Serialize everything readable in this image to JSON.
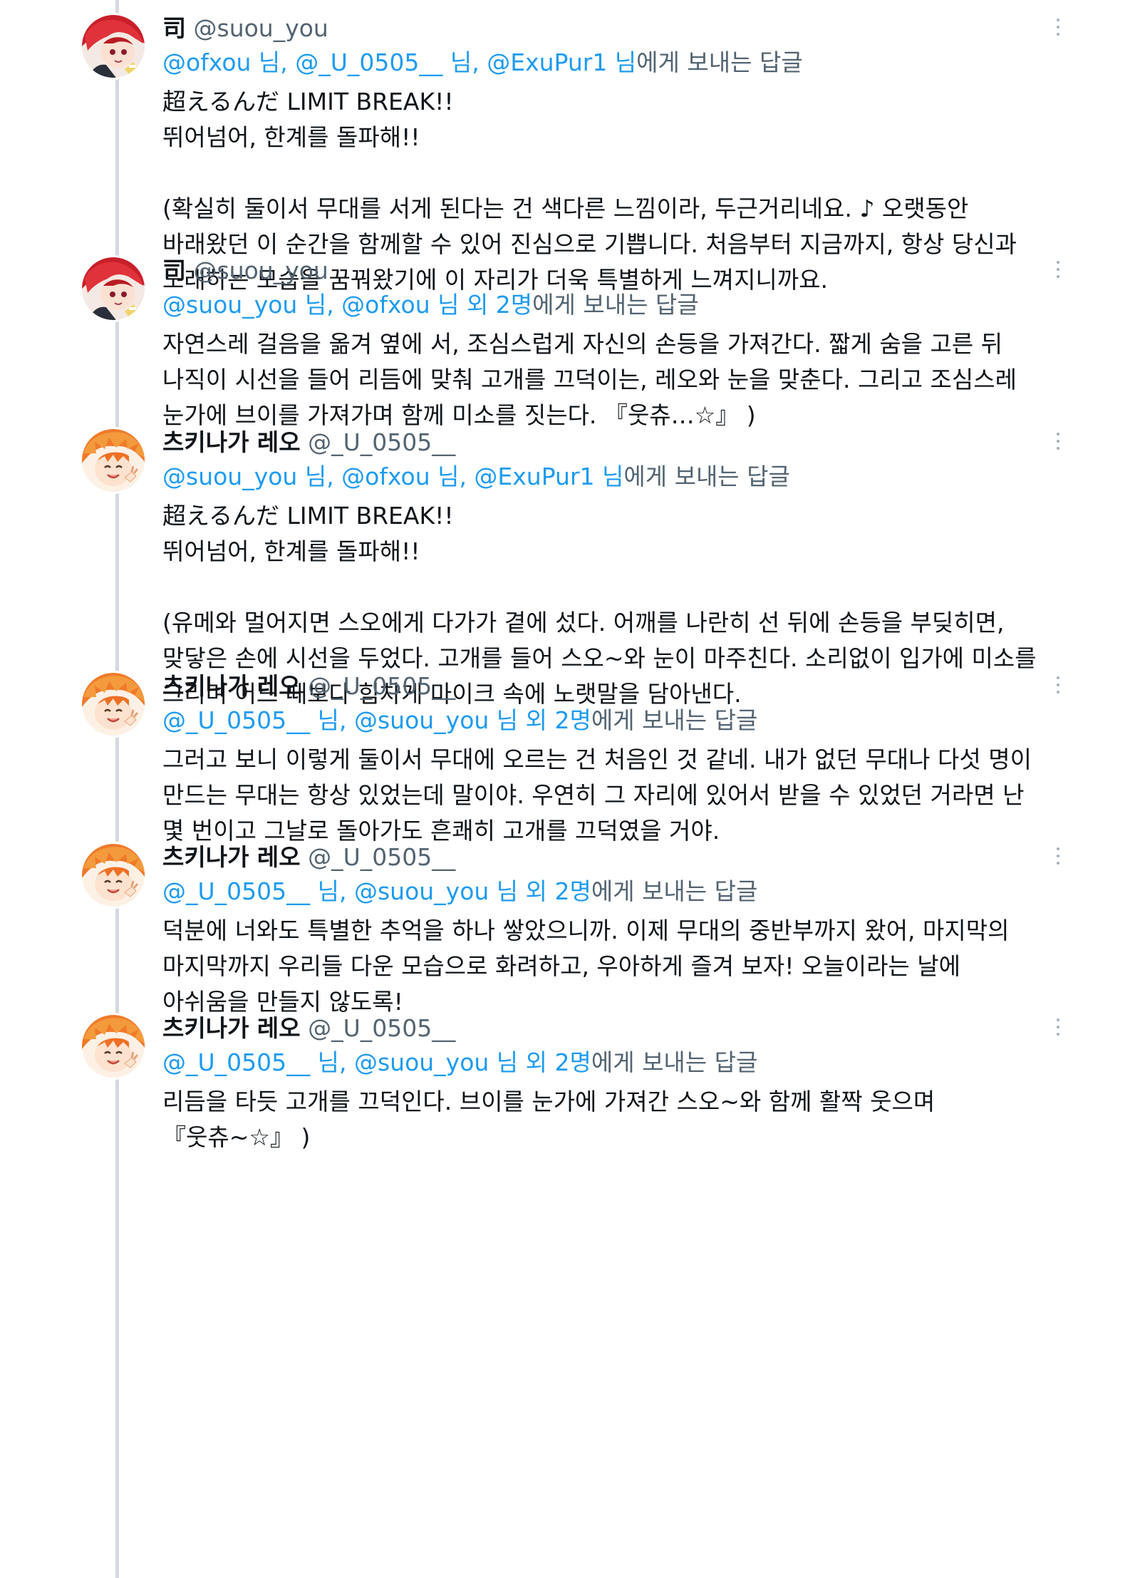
{
  "reply_prefix": "에게 보내는 답글",
  "tweets": [
    {
      "name": "司",
      "handle": "@suou_you",
      "avatar": "suou-avatar",
      "replying_to": "@ofxou 님, @_U_0505__ 님, @ExuPur1 님",
      "lines": [
        "超えるんだ LIMIT BREAK!!",
        "뛰어넘어, 한계를 돌파해!!",
        "",
        "(확실히 둘이서 무대를 서게 된다는 건 색다른 느낌이라, 두근거리네요. ♪ 오랫동안",
        "바래왔던 이 순간을 함께할 수 있어 진심으로 기쁩니다. 처음부터 지금까지, 항상 당신과",
        "노래하는 모습을 꿈꿔왔기에 이 자리가 더욱 특별하게 느껴지니까요."
      ]
    },
    {
      "name": "司",
      "handle": "@suou_you",
      "avatar": "suou-avatar",
      "replying_to": "@suou_you 님, @ofxou 님 외 2명",
      "lines": [
        "자연스레 걸음을 옮겨 옆에 서, 조심스럽게 자신의 손등을 가져간다. 짧게 숨을 고른 뒤",
        "나직이 시선을 들어 리듬에 맞춰 고개를 끄덕이는, 레오와 눈을 맞춘다. 그리고 조심스레",
        "눈가에 브이를 가져가며 함께 미소를 짓는다. 『웃츄…☆』 )"
      ]
    },
    {
      "name": "츠키나가 레오",
      "handle": "@_U_0505__",
      "avatar": "leo-avatar",
      "replying_to": "@suou_you 님, @ofxou 님, @ExuPur1 님",
      "lines": [
        "超えるんだ LIMIT BREAK!!",
        "뛰어넘어, 한계를 돌파해!!",
        "",
        "(유메와 멀어지면 스오에게 다가가 곁에 섰다. 어깨를 나란히 선 뒤에 손등을 부딪히면,",
        "맞닿은 손에 시선을 두었다. 고개를 들어 스오~와 눈이 마주친다. 소리없이 입가에 미소를",
        "그리며 어느 때보다 힘차게 마이크 속에 노랫말을 담아낸다."
      ]
    },
    {
      "name": "츠키나가 레오",
      "handle": "@_U_0505__",
      "avatar": "leo-avatar",
      "replying_to": "@_U_0505__ 님, @suou_you 님 외 2명",
      "lines": [
        "그러고 보니 이렇게 둘이서 무대에 오르는 건 처음인 것 같네. 내가 없던 무대나 다섯 명이",
        "만드는 무대는 항상 있었는데 말이야. 우연히 그 자리에 있어서 받을 수 있었던 거라면 난",
        "몇 번이고 그날로 돌아가도 흔쾌히 고개를 끄덕였을 거야."
      ]
    },
    {
      "name": "츠키나가 레오",
      "handle": "@_U_0505__",
      "avatar": "leo-avatar",
      "replying_to": "@_U_0505__ 님, @suou_you 님 외 2명",
      "lines": [
        "덕분에 너와도 특별한 추억을 하나 쌓았으니까. 이제 무대의 중반부까지 왔어, 마지막의",
        "마지막까지 우리들 다운 모습으로 화려하고, 우아하게 즐겨 보자! 오늘이라는 날에",
        "아쉬움을 만들지 않도록!"
      ]
    },
    {
      "name": "츠키나가 레오",
      "handle": "@_U_0505__",
      "avatar": "leo-avatar",
      "replying_to": "@_U_0505__ 님, @suou_you 님 외 2명",
      "lines": [
        "리듬을 타듯 고개를 끄덕인다. 브이를 눈가에 가져간 스오~와 함께 활짝 웃으며",
        "『웃츄~☆』 )"
      ]
    }
  ]
}
